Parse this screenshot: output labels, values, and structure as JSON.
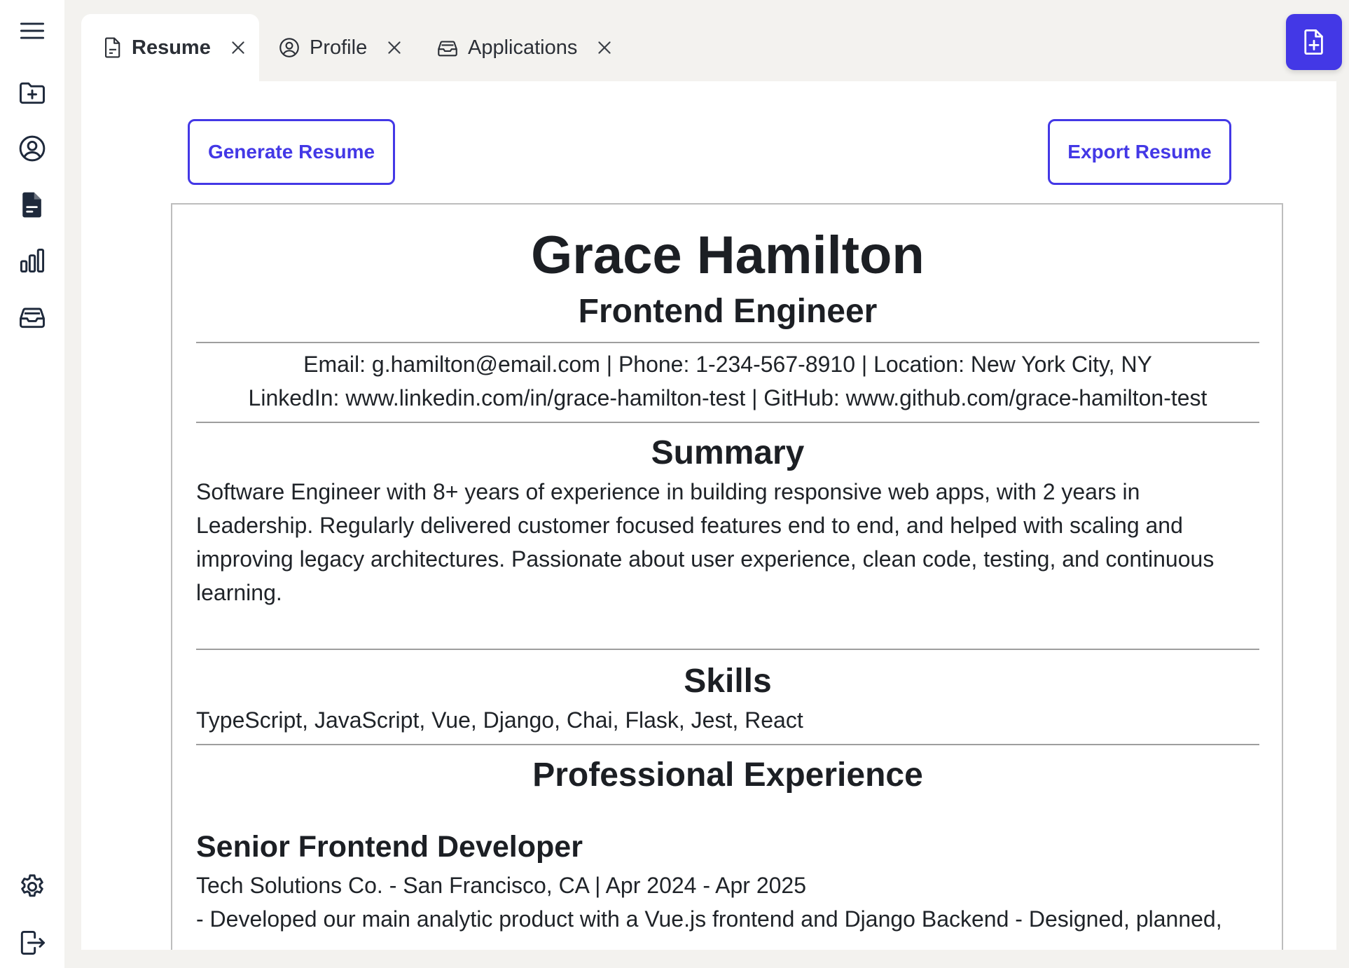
{
  "sidebar": {
    "items": [
      {
        "name": "menu",
        "icon": "hamburger-menu-icon"
      },
      {
        "name": "new-folder",
        "icon": "folder-plus-icon"
      },
      {
        "name": "profile",
        "icon": "user-circle-icon"
      },
      {
        "name": "resume",
        "icon": "document-icon"
      },
      {
        "name": "analytics",
        "icon": "bar-chart-icon"
      },
      {
        "name": "applications",
        "icon": "inbox-stack-icon"
      },
      {
        "name": "settings",
        "icon": "gear-icon"
      },
      {
        "name": "logout",
        "icon": "logout-icon"
      }
    ]
  },
  "tabs": [
    {
      "label": "Resume",
      "icon": "document-icon",
      "active": true
    },
    {
      "label": "Profile",
      "icon": "user-circle-icon",
      "active": false
    },
    {
      "label": "Applications",
      "icon": "inbox-stack-icon",
      "active": false
    }
  ],
  "toolbar": {
    "generate_label": "Generate Resume",
    "export_label": "Export Resume"
  },
  "resume": {
    "name": "Grace Hamilton",
    "role": "Frontend Engineer",
    "contact_line1": "Email: g.hamilton@email.com | Phone: 1-234-567-8910 | Location: New York City, NY",
    "contact_line2": "LinkedIn: www.linkedin.com/in/grace-hamilton-test | GitHub: www.github.com/grace-hamilton-test",
    "summary_title": "Summary",
    "summary_text": "Software Engineer with 8+ years of experience in building responsive web apps, with 2 years in Leadership. Regularly delivered customer focused features end to end, and helped with scaling and improving legacy architectures. Passionate about user experience, clean code, testing, and continuous learning.",
    "skills_title": "Skills",
    "skills_text": "TypeScript, JavaScript, Vue, Django, Chai, Flask, Jest, React",
    "experience_title": "Professional Experience",
    "jobs": [
      {
        "title": "Senior Frontend Developer",
        "meta": "Tech Solutions Co. - San Francisco, CA | Apr 2024 - Apr 2025",
        "details": "- Developed our main analytic product with a Vue.js frontend and Django Backend - Designed, planned,"
      }
    ]
  },
  "colors": {
    "accent": "#4338e6",
    "icon": "#1e293b",
    "background": "#f3f2ef"
  }
}
